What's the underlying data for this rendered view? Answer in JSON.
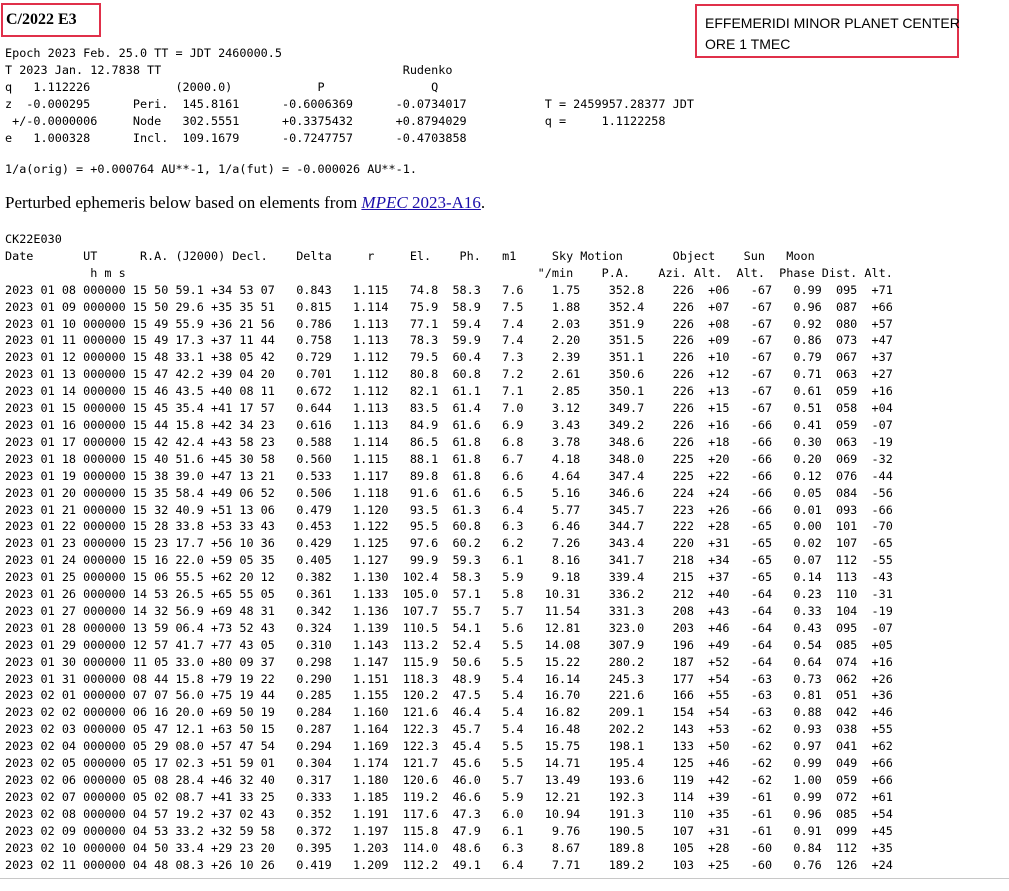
{
  "title": "C/2022 E3",
  "header_box": {
    "line1": "EFFEMERIDI MINOR PLANET CENTER",
    "line2": "ORE  1 TMEC"
  },
  "elements_block": "Epoch 2023 Feb. 25.0 TT = JDT 2460000.5\nT 2023 Jan. 12.7838 TT                                  Rudenko\nq   1.112226            (2000.0)            P               Q\nz  -0.000295      Peri.  145.8161      -0.6006369      -0.0734017           T = 2459957.28377 JDT\n +/-0.0000006     Node   302.5551      +0.3375432      +0.8794029           q =     1.1122258\ne   1.000328      Incl.  109.1679      -0.7247757      -0.4703858",
  "orbit_line": "1/a(orig) = +0.000764 AU**-1, 1/a(fut) = -0.000026 AU**-1.",
  "sentence": {
    "prefix": "Perturbed ephemeris below based on elements from ",
    "link_italic": "MPEC",
    "link_rest": " 2023-A16",
    "suffix": "."
  },
  "ephemeris": {
    "object_code": "CK22E030",
    "header_line1": "Date       UT      R.A. (J2000) Decl.    Delta     r     El.    Ph.   m1     Sky Motion       Object    Sun   Moon",
    "header_line2": "            h m s                                                          \"/min    P.A.    Azi. Alt.  Alt.  Phase Dist. Alt.",
    "rows": [
      "2023 01 08 000000 15 50 59.1 +34 53 07   0.843   1.115   74.8  58.3   7.6    1.75    352.8    226  +06   -67   0.99  095  +71",
      "2023 01 09 000000 15 50 29.6 +35 35 51   0.815   1.114   75.9  58.9   7.5    1.88    352.4    226  +07   -67   0.96  087  +66",
      "2023 01 10 000000 15 49 55.9 +36 21 56   0.786   1.113   77.1  59.4   7.4    2.03    351.9    226  +08   -67   0.92  080  +57",
      "2023 01 11 000000 15 49 17.3 +37 11 44   0.758   1.113   78.3  59.9   7.4    2.20    351.5    226  +09   -67   0.86  073  +47",
      "2023 01 12 000000 15 48 33.1 +38 05 42   0.729   1.112   79.5  60.4   7.3    2.39    351.1    226  +10   -67   0.79  067  +37",
      "2023 01 13 000000 15 47 42.2 +39 04 20   0.701   1.112   80.8  60.8   7.2    2.61    350.6    226  +12   -67   0.71  063  +27",
      "2023 01 14 000000 15 46 43.5 +40 08 11   0.672   1.112   82.1  61.1   7.1    2.85    350.1    226  +13   -67   0.61  059  +16",
      "2023 01 15 000000 15 45 35.4 +41 17 57   0.644   1.113   83.5  61.4   7.0    3.12    349.7    226  +15   -67   0.51  058  +04",
      "2023 01 16 000000 15 44 15.8 +42 34 23   0.616   1.113   84.9  61.6   6.9    3.43    349.2    226  +16   -66   0.41  059  -07",
      "2023 01 17 000000 15 42 42.4 +43 58 23   0.588   1.114   86.5  61.8   6.8    3.78    348.6    226  +18   -66   0.30  063  -19",
      "2023 01 18 000000 15 40 51.6 +45 30 58   0.560   1.115   88.1  61.8   6.7    4.18    348.0    225  +20   -66   0.20  069  -32",
      "2023 01 19 000000 15 38 39.0 +47 13 21   0.533   1.117   89.8  61.8   6.6    4.64    347.4    225  +22   -66   0.12  076  -44",
      "2023 01 20 000000 15 35 58.4 +49 06 52   0.506   1.118   91.6  61.6   6.5    5.16    346.6    224  +24   -66   0.05  084  -56",
      "2023 01 21 000000 15 32 40.9 +51 13 06   0.479   1.120   93.5  61.3   6.4    5.77    345.7    223  +26   -66   0.01  093  -66",
      "2023 01 22 000000 15 28 33.8 +53 33 43   0.453   1.122   95.5  60.8   6.3    6.46    344.7    222  +28   -65   0.00  101  -70",
      "2023 01 23 000000 15 23 17.7 +56 10 36   0.429   1.125   97.6  60.2   6.2    7.26    343.4    220  +31   -65   0.02  107  -65",
      "2023 01 24 000000 15 16 22.0 +59 05 35   0.405   1.127   99.9  59.3   6.1    8.16    341.7    218  +34   -65   0.07  112  -55",
      "2023 01 25 000000 15 06 55.5 +62 20 12   0.382   1.130  102.4  58.3   5.9    9.18    339.4    215  +37   -65   0.14  113  -43",
      "2023 01 26 000000 14 53 26.5 +65 55 05   0.361   1.133  105.0  57.1   5.8   10.31    336.2    212  +40   -64   0.23  110  -31",
      "2023 01 27 000000 14 32 56.9 +69 48 31   0.342   1.136  107.7  55.7   5.7   11.54    331.3    208  +43   -64   0.33  104  -19",
      "2023 01 28 000000 13 59 06.4 +73 52 43   0.324   1.139  110.5  54.1   5.6   12.81    323.0    203  +46   -64   0.43  095  -07",
      "2023 01 29 000000 12 57 41.7 +77 43 05   0.310   1.143  113.2  52.4   5.5   14.08    307.9    196  +49   -64   0.54  085  +05",
      "2023 01 30 000000 11 05 33.0 +80 09 37   0.298   1.147  115.9  50.6   5.5   15.22    280.2    187  +52   -64   0.64  074  +16",
      "2023 01 31 000000 08 44 15.8 +79 19 22   0.290   1.151  118.3  48.9   5.4   16.14    245.3    177  +54   -63   0.73  062  +26",
      "2023 02 01 000000 07 07 56.0 +75 19 44   0.285   1.155  120.2  47.5   5.4   16.70    221.6    166  +55   -63   0.81  051  +36",
      "2023 02 02 000000 06 16 20.0 +69 50 19   0.284   1.160  121.6  46.4   5.4   16.82    209.1    154  +54   -63   0.88  042  +46",
      "2023 02 03 000000 05 47 12.1 +63 50 15   0.287   1.164  122.3  45.7   5.4   16.48    202.2    143  +53   -62   0.93  038  +55",
      "2023 02 04 000000 05 29 08.0 +57 47 54   0.294   1.169  122.3  45.4   5.5   15.75    198.1    133  +50   -62   0.97  041  +62",
      "2023 02 05 000000 05 17 02.3 +51 59 01   0.304   1.174  121.7  45.6   5.5   14.71    195.4    125  +46   -62   0.99  049  +66",
      "2023 02 06 000000 05 08 28.4 +46 32 40   0.317   1.180  120.6  46.0   5.7   13.49    193.6    119  +42   -62   1.00  059  +66",
      "2023 02 07 000000 05 02 08.7 +41 33 25   0.333   1.185  119.2  46.6   5.9   12.21    192.3    114  +39   -61   0.99  072  +61",
      "2023 02 08 000000 04 57 19.2 +37 02 43   0.352   1.191  117.6  47.3   6.0   10.94    191.3    110  +35   -61   0.96  085  +54",
      "2023 02 09 000000 04 53 33.2 +32 59 58   0.372   1.197  115.8  47.9   6.1    9.76    190.5    107  +31   -61   0.91  099  +45",
      "2023 02 10 000000 04 50 33.4 +29 23 20   0.395   1.203  114.0  48.6   6.3    8.67    189.8    105  +28   -60   0.84  112  +35",
      "2023 02 11 000000 04 48 08.3 +26 10 26   0.419   1.209  112.2  49.1   6.4    7.71    189.2    103  +25   -60   0.76  126  +24"
    ]
  }
}
